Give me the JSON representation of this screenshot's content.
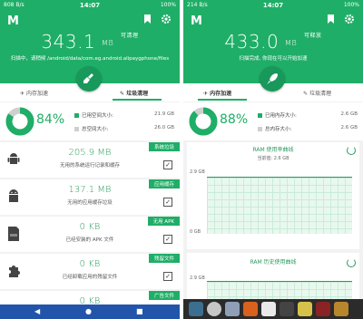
{
  "left": {
    "status": {
      "left": "808 B/s",
      "time": "14:07",
      "right": "100%"
    },
    "header": {
      "logo": "M",
      "value": "343.1",
      "unit": "MB",
      "value_label": "可清理",
      "subtitle": "扫描中，请稍候 /android/data/com.eg.android.alipaygphone/files"
    },
    "tabs": {
      "memory": "内存加速",
      "junk": "垃圾清理"
    },
    "summary": {
      "percent": "84%",
      "used_label": "已用空间大小:",
      "used_value": "21.9 GB",
      "total_label": "总空间大小:",
      "total_value": "26.0 GB",
      "fraction": 0.84
    },
    "cards": [
      {
        "tag": "系统垃圾",
        "value": "205.9 MB",
        "desc": "无用的系统运行记录和缓存",
        "icon": "android-icon"
      },
      {
        "tag": "应用缓存",
        "value": "137.1 MB",
        "desc": "无用的应用缓存垃圾",
        "icon": "android-robot-icon"
      },
      {
        "tag": "无用 APK",
        "value": "0 KB",
        "desc": "已经安装的 APK 文件",
        "icon": "apk-file-icon"
      },
      {
        "tag": "残留文件",
        "value": "0 KB",
        "desc": "已经卸载应用的残留文件",
        "icon": "puzzle-icon"
      },
      {
        "tag": "广告文件",
        "value": "0 KB",
        "desc": "",
        "icon": "ad-icon"
      }
    ],
    "checkmark": "✓",
    "nav": {
      "back": "◀",
      "home": "●",
      "recent": "■"
    }
  },
  "right": {
    "status": {
      "left": "214 B/s",
      "time": "14:07",
      "right": "100%"
    },
    "header": {
      "logo": "M",
      "value": "433.0",
      "unit": "MB",
      "value_label": "可释放",
      "subtitle": "扫描完成, 你现在可以开始加速"
    },
    "tabs": {
      "memory": "内存加速",
      "junk": "垃圾清理"
    },
    "summary": {
      "percent": "88%",
      "used_label": "已用内存大小:",
      "used_value": "2.6 GB",
      "total_label": "总内存大小:",
      "total_value": "2.6 GB",
      "fraction": 0.88
    },
    "ram_usage": {
      "title": "RAM 使用率曲线",
      "current": "当前值: 2.6 GB",
      "y_max": "2.9 GB",
      "y_min": "0 GB"
    },
    "ram_history": {
      "title": "RAM 历史使用曲线",
      "y_max": "2.9 GB"
    }
  },
  "colors": {
    "primary": "#1fae67",
    "primary_dark": "#18985a",
    "gray": "#cfcfcf"
  }
}
